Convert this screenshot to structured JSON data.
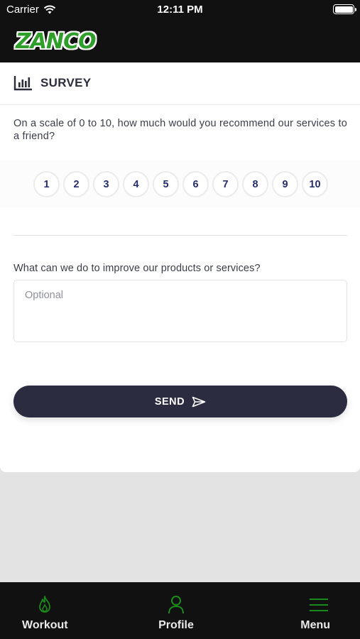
{
  "status_bar": {
    "carrier": "Carrier",
    "time": "12:11 PM"
  },
  "brand": {
    "logo_text": "ZANCO"
  },
  "survey": {
    "title": "SURVEY",
    "question1": "On a scale of 0 to 10, how much would you recommend our services to a friend?",
    "scale": [
      "1",
      "2",
      "3",
      "4",
      "5",
      "6",
      "7",
      "8",
      "9",
      "10"
    ],
    "question2": "What can we do to improve our products or services?",
    "feedback_placeholder": "Optional",
    "feedback_value": "",
    "send_label": "SEND"
  },
  "tabbar": {
    "workout": "Workout",
    "profile": "Profile",
    "menu": "Menu"
  },
  "colors": {
    "accent_green": "#1a8a1a",
    "button_dark": "#2b2c40",
    "number_text": "#262d6b"
  }
}
